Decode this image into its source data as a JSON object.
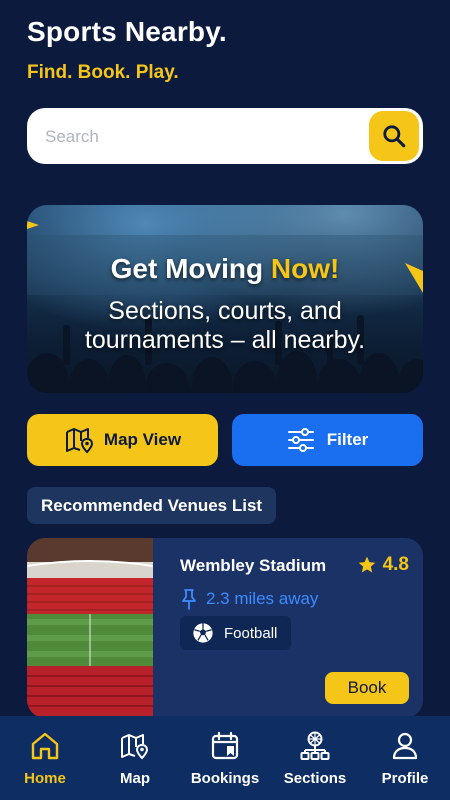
{
  "header": {
    "title": "Sports Nearby.",
    "tagline": "Find. Book. Play."
  },
  "search": {
    "placeholder": "Search",
    "value": "",
    "icon": "search-icon"
  },
  "hero": {
    "headline_part1": "Get Moving",
    "headline_part2": "Now!",
    "subtext": "Sections, courts, and tournaments – all nearby."
  },
  "actions": {
    "map_view_label": "Map View",
    "filter_label": "Filter"
  },
  "section": {
    "title": "Recommended Venues List"
  },
  "venues": [
    {
      "name": "Wembley Stadium",
      "rating": "4.8",
      "distance": "2.3 miles away",
      "sport": "Football",
      "book_label": "Book"
    }
  ],
  "nav": {
    "items": [
      {
        "label": "Home",
        "icon": "home-icon",
        "active": true
      },
      {
        "label": "Map",
        "icon": "map-icon",
        "active": false
      },
      {
        "label": "Bookings",
        "icon": "bookings-icon",
        "active": false
      },
      {
        "label": "Sections",
        "icon": "sections-icon",
        "active": false
      },
      {
        "label": "Profile",
        "icon": "profile-icon",
        "active": false
      }
    ]
  },
  "colors": {
    "background": "#0b1a3d",
    "accent": "#f5c518",
    "primary_blue": "#1a6ff0",
    "card": "#1b3266",
    "nav_bar": "#0d2d63"
  }
}
